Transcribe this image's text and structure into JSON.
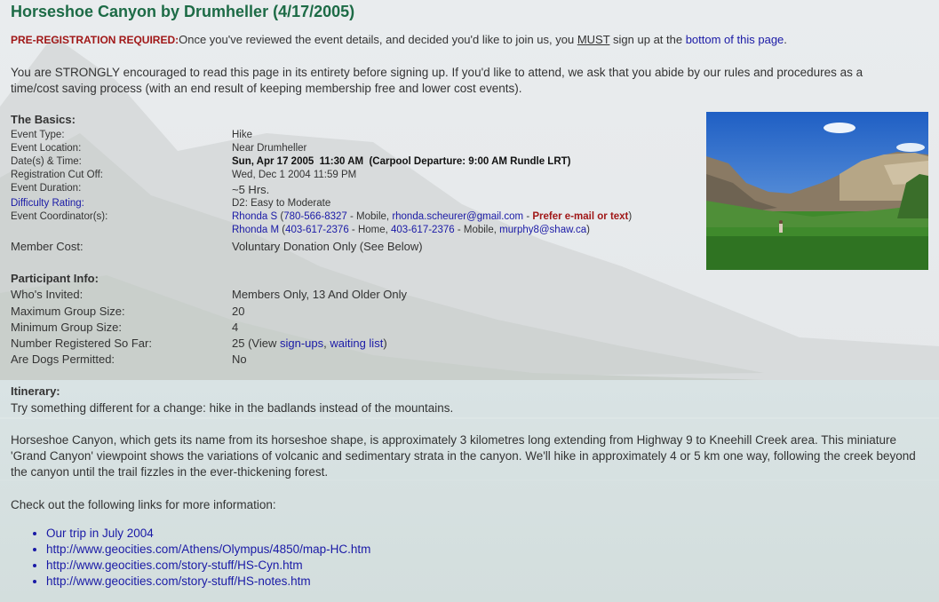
{
  "page": {
    "title": "Horseshoe Canyon by Drumheller (4/17/2005)"
  },
  "prereg": {
    "label": "PRE-REGISTRATION REQUIRED:",
    "text_before_must": "Once you've reviewed the event details, and decided you'd like to join us, you ",
    "must": "MUST",
    "text_after_must": " sign up at the ",
    "link": "bottom of this page",
    "end": "."
  },
  "strongly_text": "You are STRONGLY encouraged to read this page in its entirety before signing up. If you'd like to attend, we ask that you abide by our rules and procedures as a time/cost saving process (with an end result of keeping membership free and lower cost events).",
  "basics": {
    "heading": "The Basics:",
    "event_type_label": "Event Type:",
    "event_type": "Hike",
    "location_label": "Event Location:",
    "location": "Near Drumheller",
    "date_label": "Date(s) & Time:",
    "date": "Sun, Apr 17 2005  11:30 AM  (Carpool Departure: 9:00 AM Rundle LRT)",
    "cutoff_label": "Registration Cut Off:",
    "cutoff": "Wed, Dec 1 2004 11:59 PM",
    "duration_label": "Event Duration:",
    "duration": "~5 Hrs.",
    "difficulty_label": "Difficulty Rating:",
    "difficulty": "D2: Easy to Moderate",
    "coordinator_label": "Event Coordinator(s):",
    "coord1_name": "Rhonda S",
    "coord1_phone": "780-566-8327",
    "coord1_phone_type": " - Mobile, ",
    "coord1_email": "rhonda.scheurer@gmail.com",
    "coord1_sep": " - ",
    "coord1_prefer": "Prefer e-mail or text",
    "coord2_name": "Rhonda M",
    "coord2_phone1": "403-617-2376",
    "coord2_phone1_type": " - Home, ",
    "coord2_phone2": "403-617-2376",
    "coord2_phone2_type": " - Mobile, ",
    "coord2_email": "murphy8@shaw.ca",
    "cost_label": "Member Cost:",
    "cost": "Voluntary Donation Only (See Below)"
  },
  "participant": {
    "heading": "Participant Info:",
    "invited_label": "Who's Invited:",
    "invited": "Members Only, 13 And Older Only",
    "max_label": "Maximum Group Size:",
    "max": "20",
    "min_label": "Minimum Group Size:",
    "min": "4",
    "registered_label": "Number Registered So Far:",
    "registered_count": "25 (View ",
    "signups_link": "sign-ups",
    "waiting_link": "waiting list",
    "dogs_label": "Are Dogs Permitted:",
    "dogs": "No"
  },
  "itinerary": {
    "heading": "Itinerary:",
    "p1": "Try something different for a change: hike in the badlands instead of the mountains.",
    "p2": "Horseshoe Canyon, which gets its name from its horseshoe shape, is approximately 3 kilometres long extending from Highway 9 to Kneehill Creek area. This miniature 'Grand Canyon' viewpoint shows the variations of volcanic and sedimentary strata in the canyon. We'll hike in approximately 4 or 5 km one way, following the creek beyond the canyon until the trail fizzles in the ever-thickening forest.",
    "p3": "Check out the following links for more information:",
    "links": [
      "Our trip in July 2004",
      "http://www.geocities.com/Athens/Olympus/4850/map-HC.htm",
      "http://www.geocities.com/story-stuff/HS-Cyn.htm",
      "http://www.geocities.com/story-stuff/HS-notes.htm"
    ]
  }
}
